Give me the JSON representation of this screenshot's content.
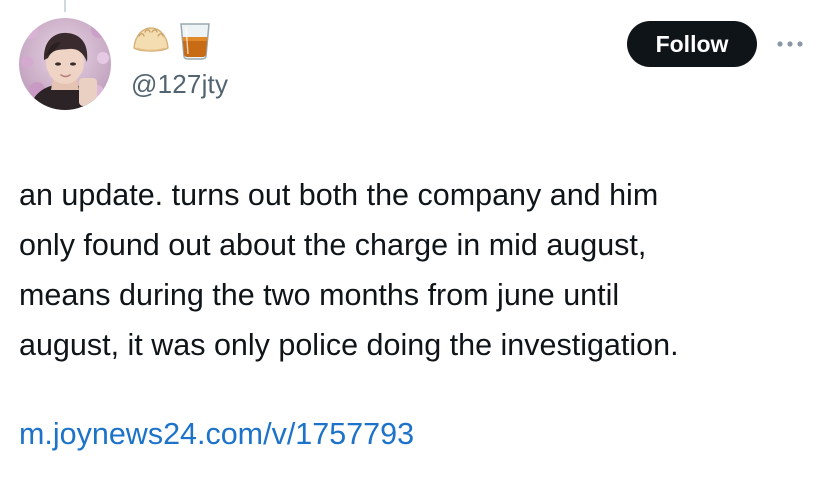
{
  "colors": {
    "text_primary": "#0f1419",
    "text_secondary": "#536471",
    "link": "#1d73c9",
    "follow_button_bg": "#0f1419",
    "follow_button_text": "#ffffff"
  },
  "author": {
    "display_name_icons": [
      "dumpling-emoji-icon",
      "whiskey-glass-emoji-icon"
    ],
    "handle": "@127jty",
    "avatar": "profile-photo-avatar"
  },
  "header": {
    "follow_label": "Follow",
    "more_icon": "ellipsis-icon"
  },
  "tweet": {
    "lines": [
      "an update. turns out both the company and him",
      "only found out about the charge in mid august,",
      "means during the two months from june until",
      "august, it was only police doing the investigation."
    ],
    "link_text": "m.joynews24.com/v/1757793"
  }
}
